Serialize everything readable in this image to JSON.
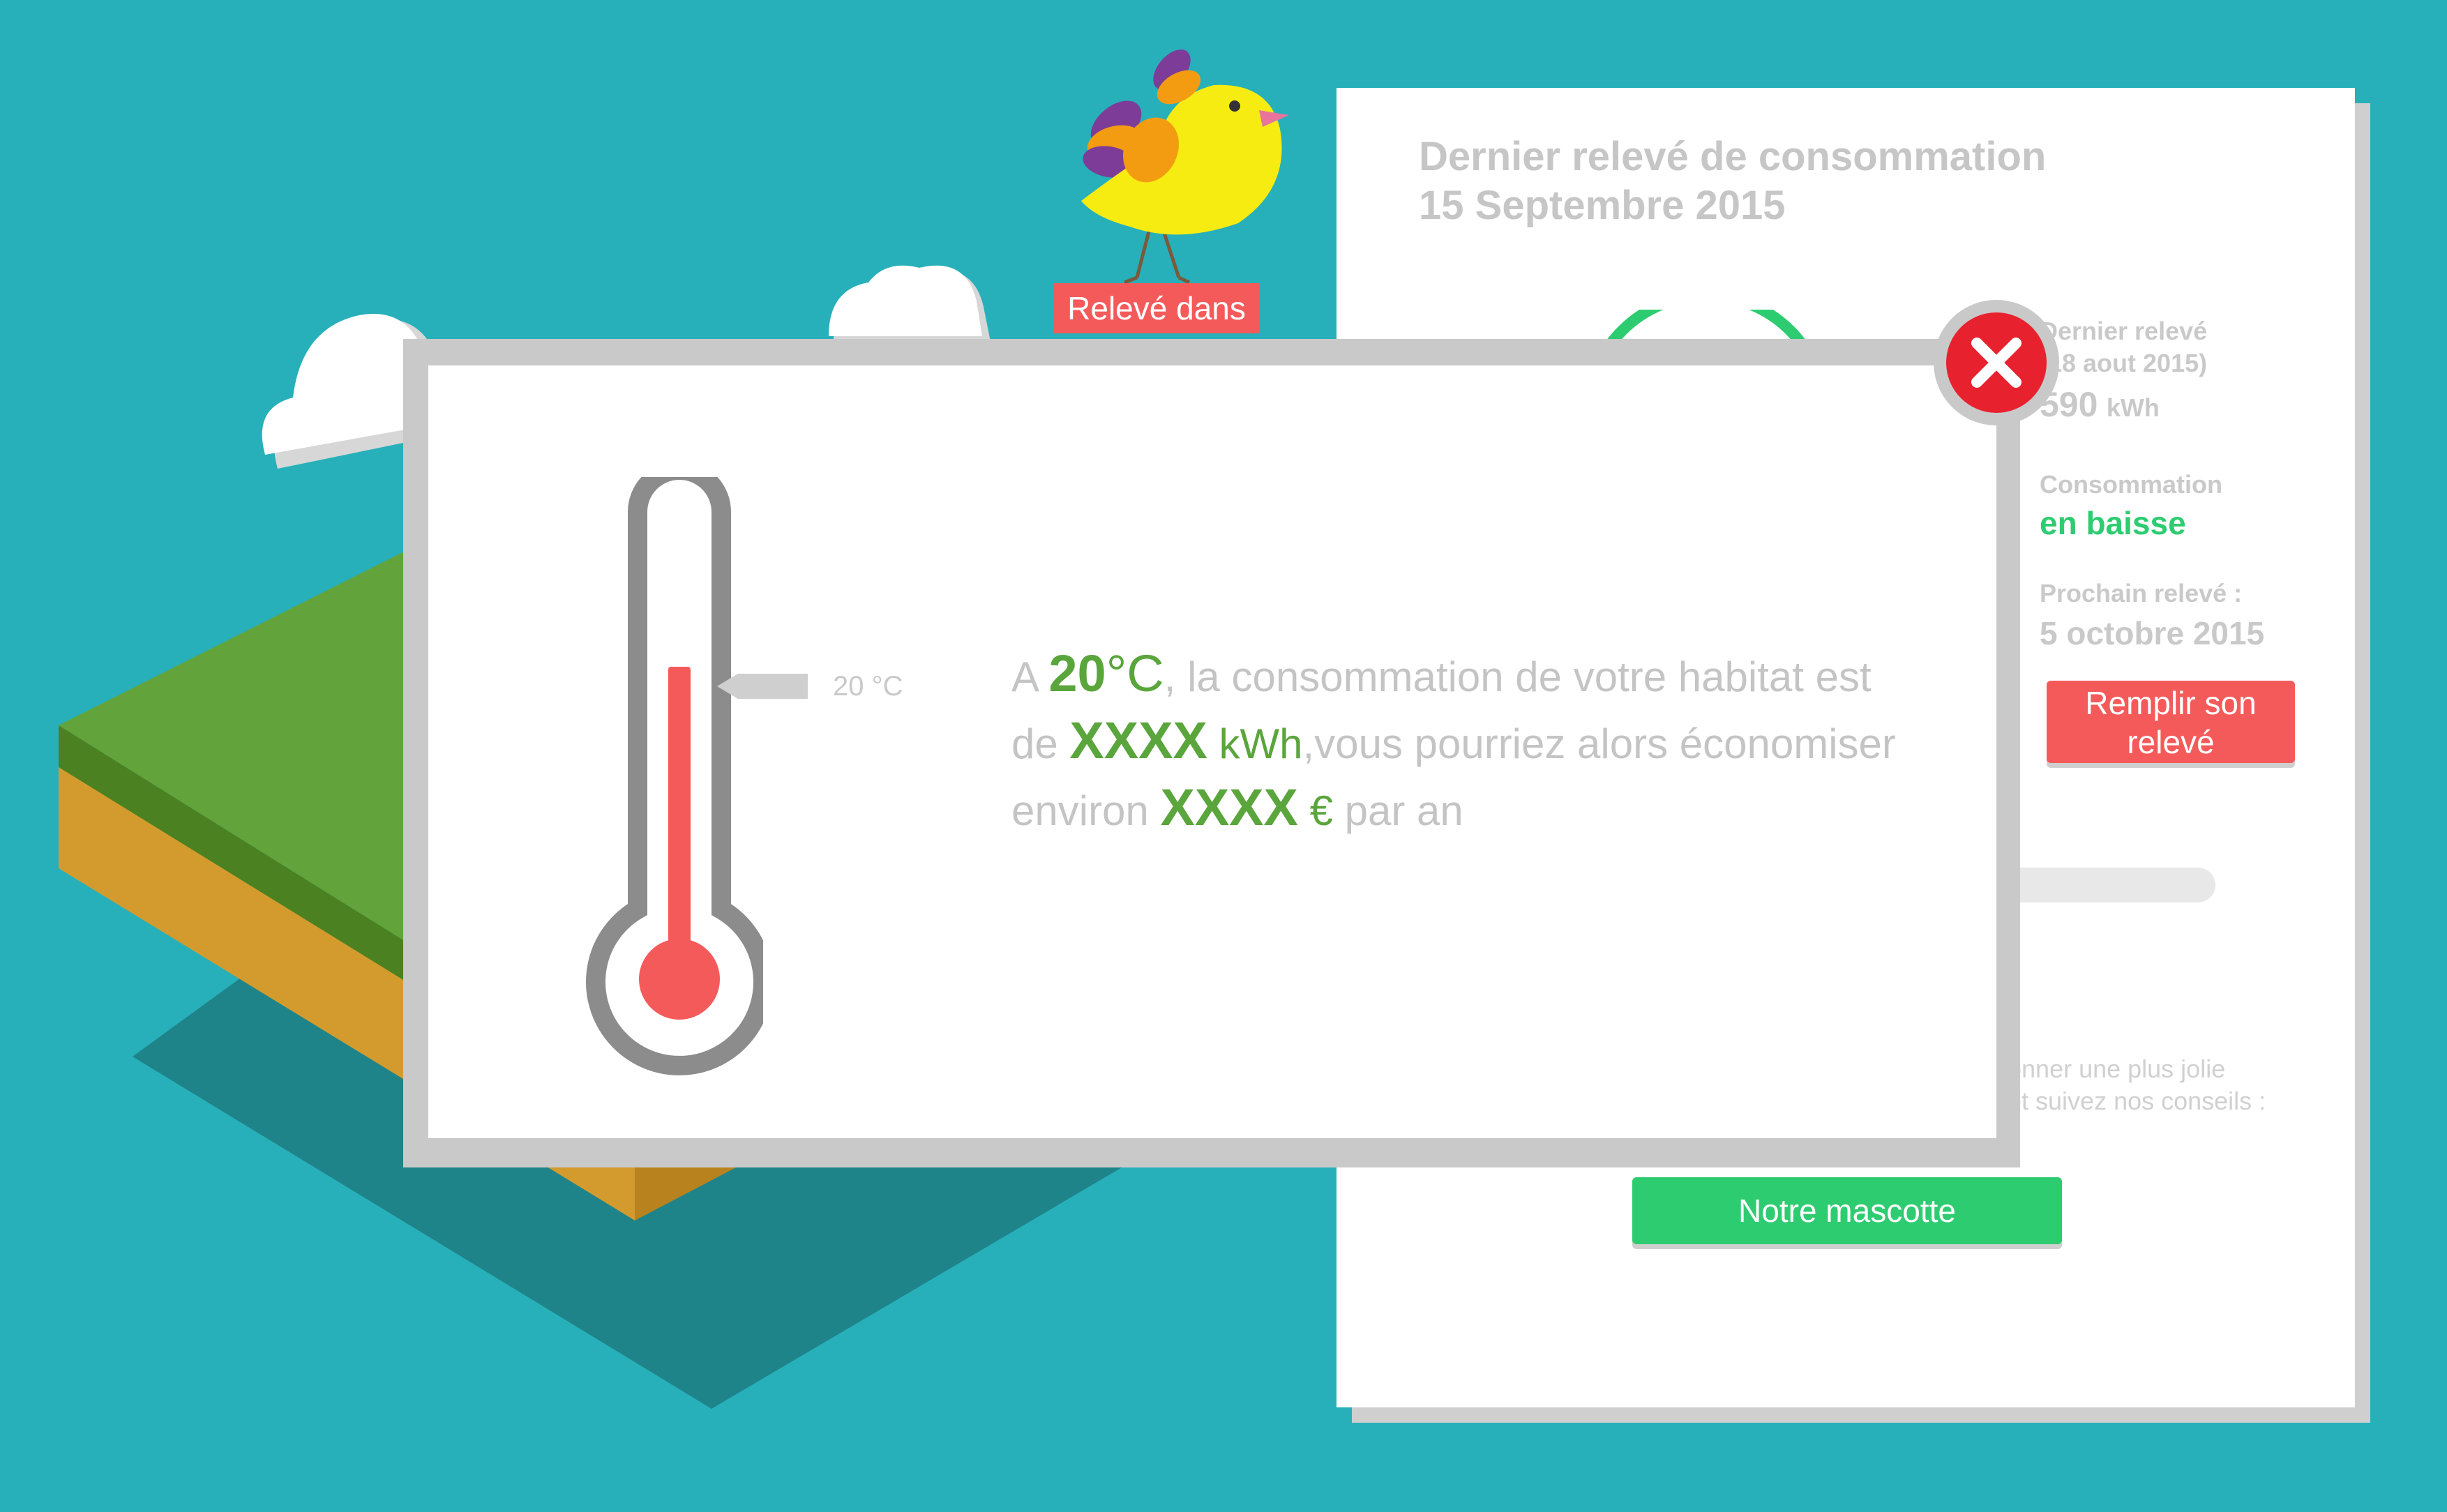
{
  "panel": {
    "title_line1": "Dernier relevé de consommation",
    "title_line2": "15 Septembre 2015",
    "last_reading_label": "Dernier relevé",
    "last_reading_date": "(18 aout 2015)",
    "last_reading_value": "590",
    "last_reading_unit": "kWh",
    "consumption_label": "Consommation",
    "consumption_trend": "en baisse",
    "next_reading_label": "Prochain relevé :",
    "next_reading_date": "5 octobre 2015",
    "fill_button": "Remplir son relevé",
    "advice_line1": "onner une plus jolie",
    "advice_line2": "et suivez nos conseils :",
    "mascot_button": "Notre mascotte"
  },
  "mascot": {
    "tag_label": "Relevé dans"
  },
  "modal": {
    "thermometer_marker": "20 °C",
    "text_a": "A ",
    "temp_value": "20",
    "temp_unit": "°C",
    "text_b": ", la consommation de votre habitat est de ",
    "kwh_value": "XXXX",
    "kwh_unit": " kWh",
    "text_c": ",vous pourriez alors économiser environ ",
    "eur_value": "XXXX",
    "eur_unit": " €",
    "text_d": " par an"
  },
  "colors": {
    "background": "#27b0ba",
    "accent_red": "#f55a5a",
    "accent_green": "#2ecc71",
    "value_green": "#5aa53c",
    "close_red": "#e8212e"
  },
  "icons": {
    "close": "close-icon",
    "thermometer": "thermometer-icon",
    "mascot": "bird-mascot-icon"
  }
}
